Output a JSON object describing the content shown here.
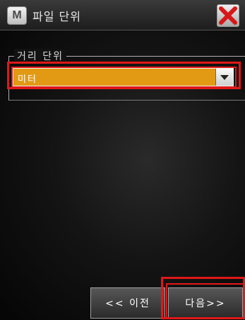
{
  "window": {
    "title": "파일 단위",
    "app_icon_letter": "M",
    "close_icon": "close-x-icon",
    "close_color": "#e02020"
  },
  "distance_unit": {
    "group_label": "거리 단위",
    "selected_value": "미터",
    "accent_color": "#e29a14"
  },
  "footer": {
    "prev_label": "<< 이전",
    "next_label": "다음>>"
  },
  "highlight_color": "#e01818"
}
